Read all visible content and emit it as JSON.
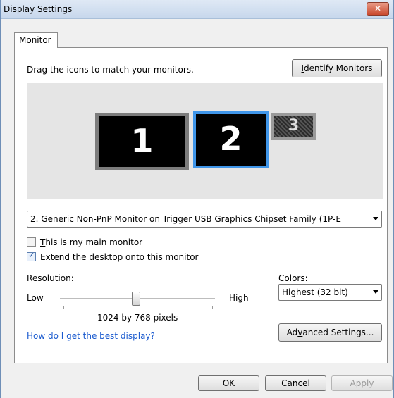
{
  "window": {
    "title": "Display Settings",
    "close_glyph": "✕"
  },
  "tabs": [
    {
      "label": "Monitor"
    }
  ],
  "monitor": {
    "instruction": "Drag the icons to match your monitors.",
    "identify_button": {
      "access_key": "I",
      "rest": "dentify Monitors"
    },
    "monitors": [
      "1",
      "2",
      "3"
    ],
    "selected_monitor": "2. Generic Non-PnP Monitor on Trigger USB Graphics Chipset Family (1P-E",
    "main_monitor": {
      "access_key": "T",
      "rest": "his is my main monitor",
      "checked": false
    },
    "extend_desktop": {
      "access_key": "E",
      "rest": "xtend the desktop onto this monitor",
      "checked": true
    },
    "resolution": {
      "label_key": "R",
      "label_rest": "esolution:",
      "low": "Low",
      "high": "High",
      "slider_fraction": 0.46,
      "value": "1024 by 768 pixels"
    },
    "colors": {
      "label_key": "C",
      "label_rest": "olors:",
      "value": "Highest (32 bit)"
    },
    "help_link": "How do I get the best display?",
    "advanced_button": {
      "pre": "Ad",
      "access_key": "v",
      "post": "anced Settings..."
    }
  },
  "footer": {
    "ok": "OK",
    "cancel": "Cancel",
    "apply": "Apply"
  },
  "colors_theme": {
    "accent": "#3f95e8",
    "link": "#1b5bcf",
    "titlebar": "#c7d7ec"
  },
  "icons": {
    "close": "close-icon",
    "checkmark": "checkmark-icon",
    "dropdown": "chevron-down-icon"
  }
}
